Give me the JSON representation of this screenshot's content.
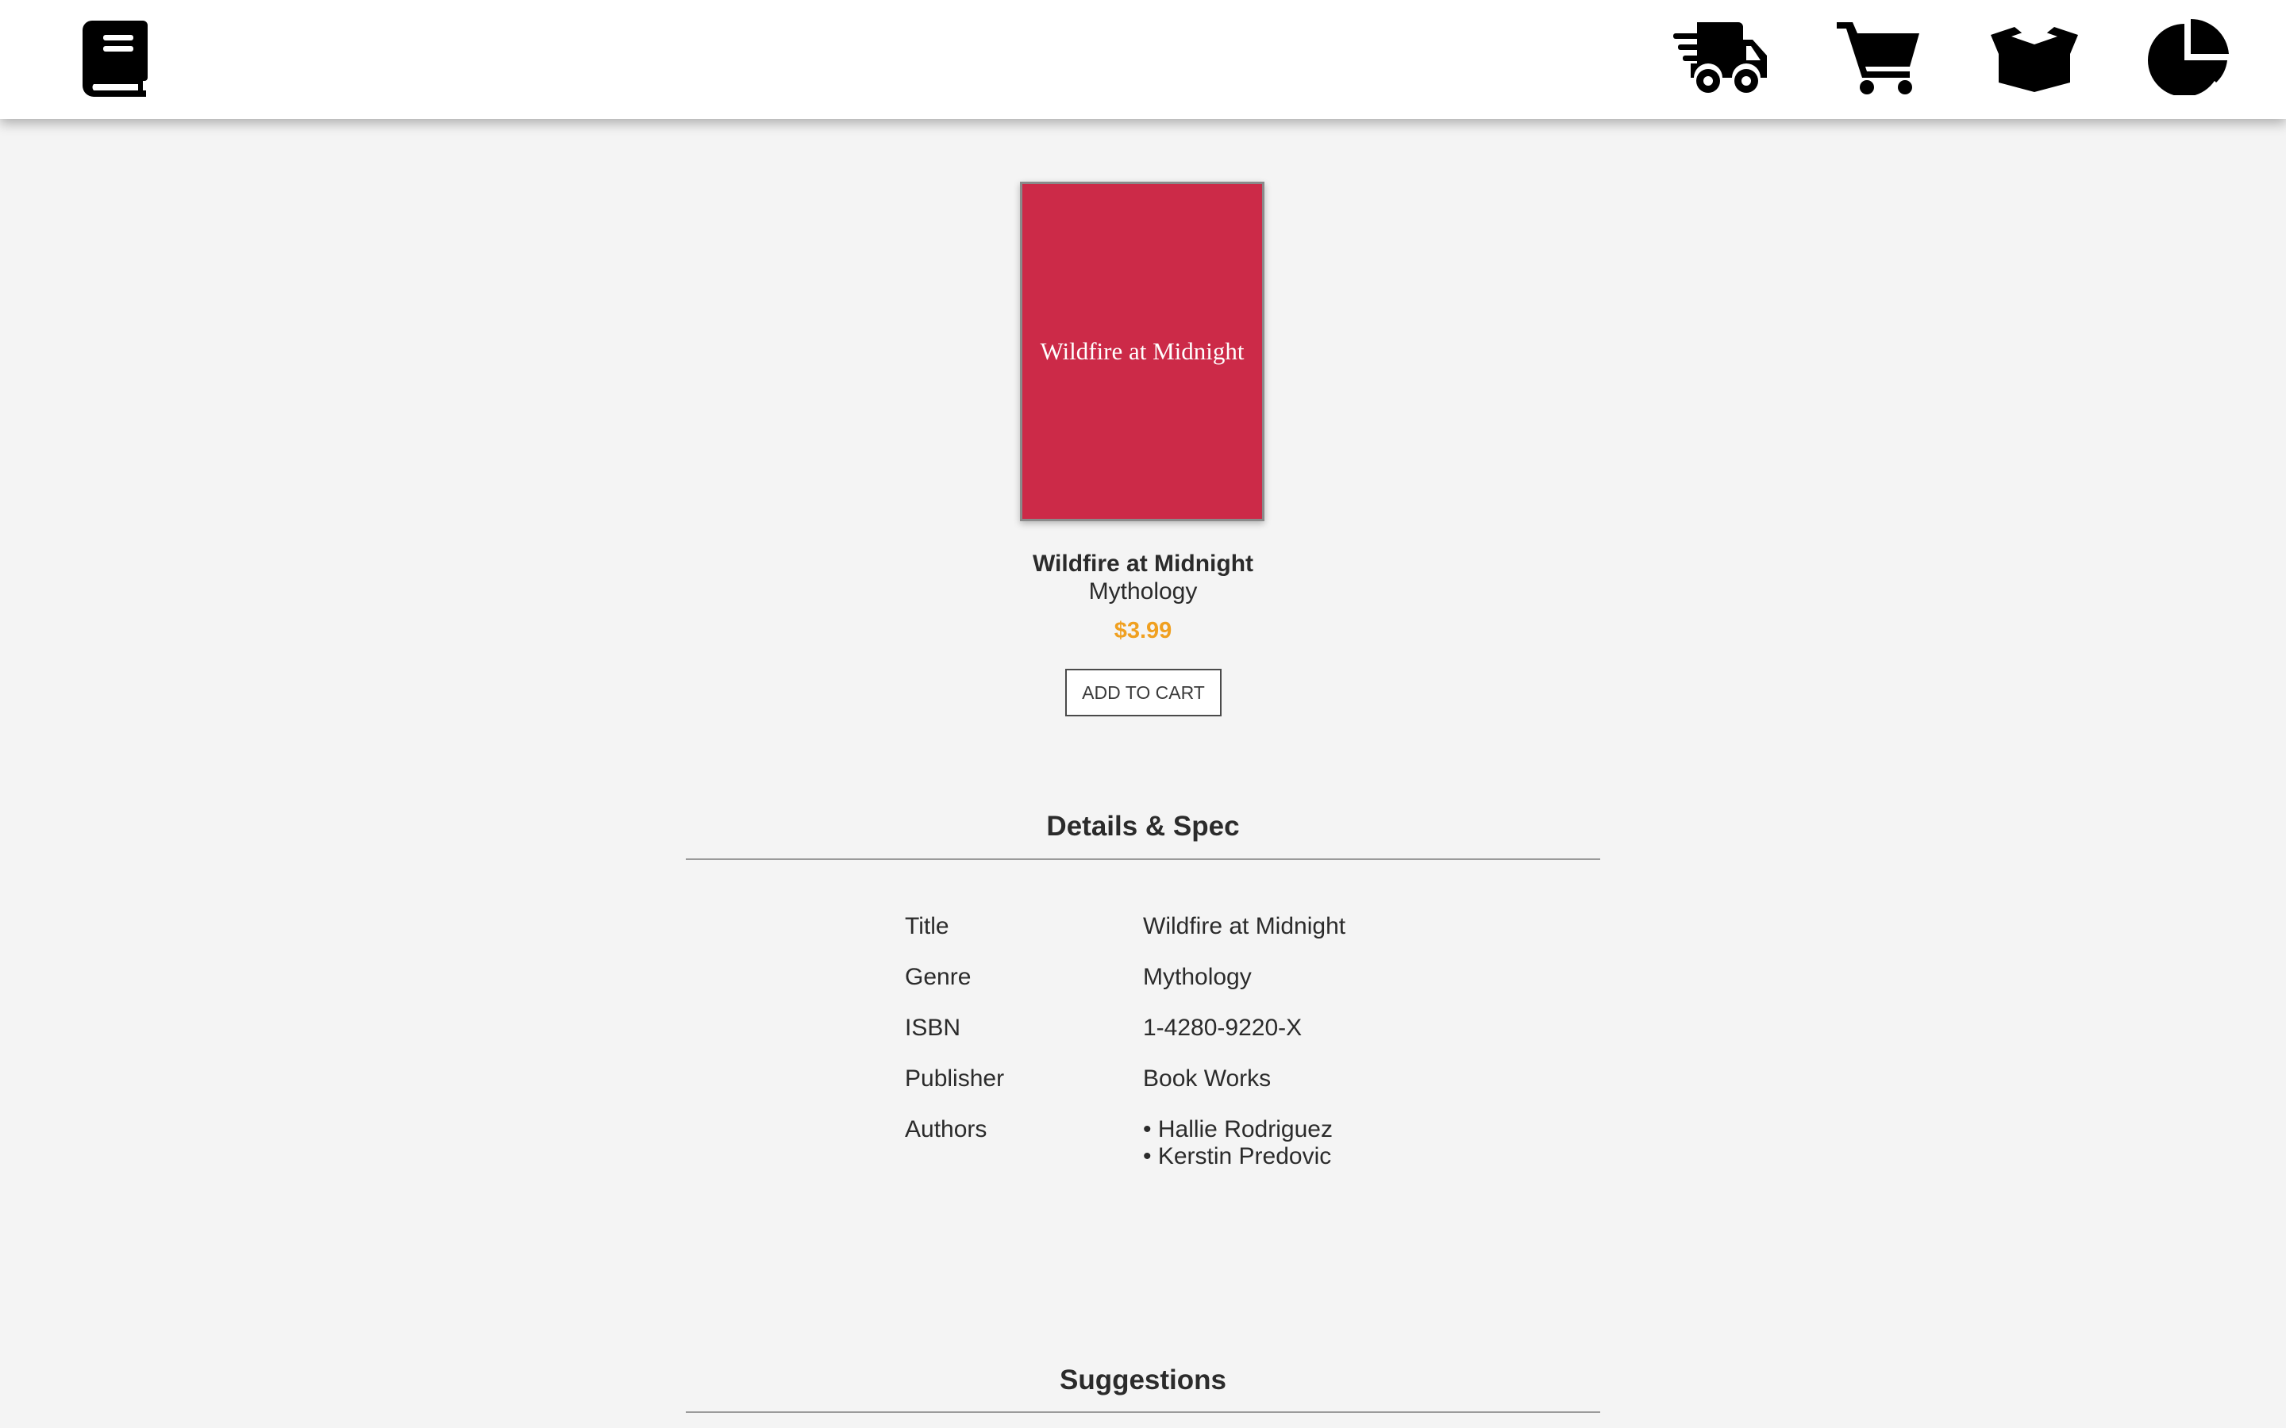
{
  "nav": {
    "logo_icon": "book-icon",
    "icons": [
      "shipping-fast-icon",
      "shopping-cart-icon",
      "open-box-icon",
      "pie-chart-icon"
    ]
  },
  "book": {
    "cover_title": "Wildfire at Midnight",
    "cover_color": "#cc2a48",
    "title": "Wildfire at Midnight",
    "genre": "Mythology",
    "price": "$3.99",
    "price_color": "#f0a020",
    "add_to_cart_label": "ADD TO CART"
  },
  "details": {
    "heading": "Details & Spec",
    "rows": [
      {
        "label": "Title",
        "value": "Wildfire at Midnight"
      },
      {
        "label": "Genre",
        "value": "Mythology"
      },
      {
        "label": "ISBN",
        "value": "1-4280-9220-X"
      },
      {
        "label": "Publisher",
        "value": "Book Works"
      },
      {
        "label": "Authors",
        "values": [
          "• Hallie Rodriguez",
          "• Kerstin Predovic"
        ]
      }
    ]
  },
  "suggestions": {
    "heading": "Suggestions"
  }
}
